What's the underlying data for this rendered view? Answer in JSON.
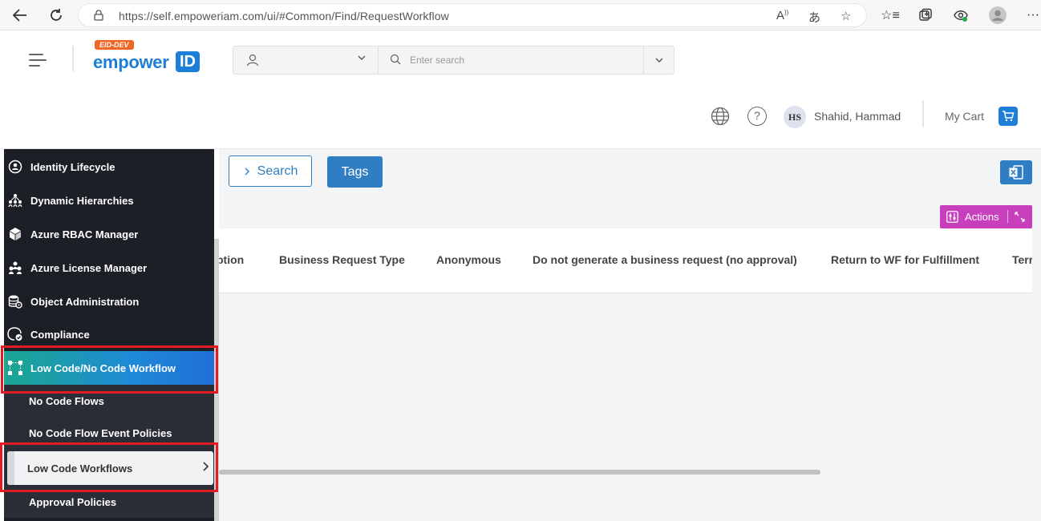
{
  "browser": {
    "url": "https://self.empoweriam.com/ui/#Common/Find/RequestWorkflow"
  },
  "header": {
    "env_badge": "EID-DEV",
    "logo_text": "empower",
    "logo_id": "ID",
    "search_placeholder": "Enter search",
    "user_initials": "HS",
    "user_name": "Shahid, Hammad",
    "cart_label": "My Cart"
  },
  "sidebar": {
    "items": [
      {
        "label": "Identity Lifecycle",
        "icon": "identity-icon"
      },
      {
        "label": "Dynamic Hierarchies",
        "icon": "hierarchy-icon"
      },
      {
        "label": "Azure RBAC Manager",
        "icon": "cube-icon"
      },
      {
        "label": "Azure License Manager",
        "icon": "license-icon"
      },
      {
        "label": "Object Administration",
        "icon": "database-gear-icon"
      },
      {
        "label": "Compliance",
        "icon": "compliance-icon"
      },
      {
        "label": "Low Code/No Code Workflow",
        "icon": "workflow-icon"
      }
    ],
    "subitems": [
      {
        "label": "No Code Flows"
      },
      {
        "label": "No Code Flow Event Policies"
      },
      {
        "label": "Low Code Workflows"
      },
      {
        "label": "Approval Policies"
      }
    ]
  },
  "toolbar": {
    "search_label": "Search",
    "tags_label": "Tags",
    "actions_label": "Actions"
  },
  "table": {
    "columns": [
      "ption",
      "Business Request Type",
      "Anonymous",
      "Do not generate a business request (no approval)",
      "Return to WF for Fulfillment",
      "Terr"
    ]
  },
  "colors": {
    "primary": "#2f7ec4",
    "actions": "#c83fbd",
    "sidebar_bg": "#1d1f26",
    "highlight": "#e01b22",
    "badge": "#f26522"
  }
}
